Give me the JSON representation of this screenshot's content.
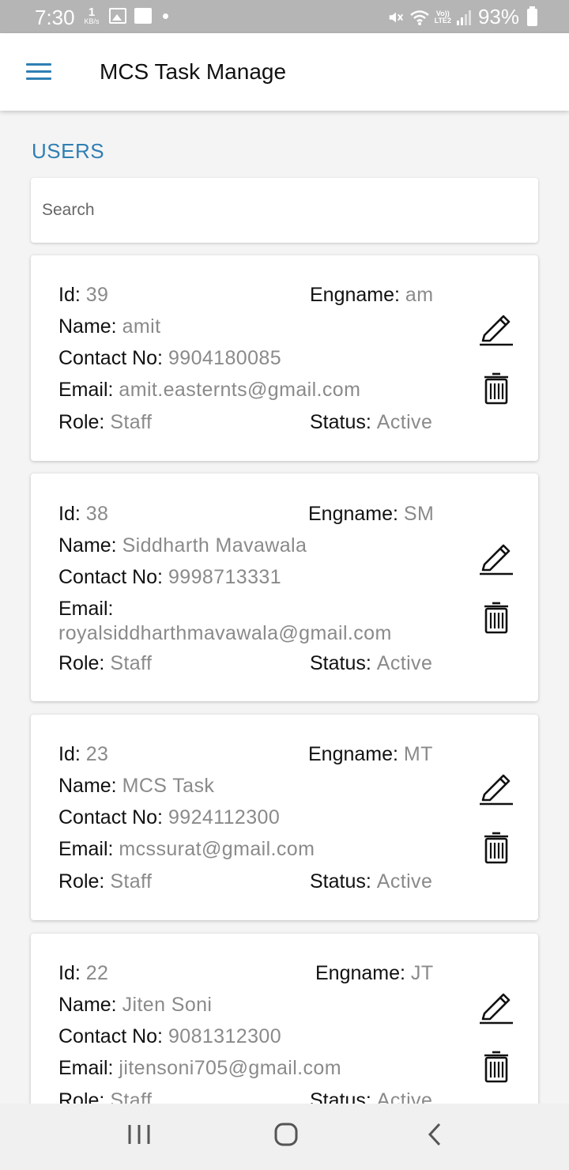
{
  "status_bar": {
    "time": "7:30",
    "net_speed": "1",
    "net_unit": "KB/s",
    "lte_top": "Vo))",
    "lte_bottom": "LTE2",
    "battery": "93%"
  },
  "app_bar": {
    "title": "MCS Task Manage"
  },
  "page": {
    "section_title": "USERS"
  },
  "search": {
    "placeholder": "Search",
    "value": ""
  },
  "labels": {
    "id": "Id:",
    "engname": "Engname:",
    "name": "Name:",
    "contact": "Contact No:",
    "email": "Email:",
    "role": "Role:",
    "status": "Status:"
  },
  "users": [
    {
      "id": "39",
      "engname": "am",
      "name": "amit",
      "contact": "9904180085",
      "email": "amit.easternts@gmail.com",
      "role": "Staff",
      "status": "Active"
    },
    {
      "id": "38",
      "engname": "SM",
      "name": "Siddharth Mavawala",
      "contact": "9998713331",
      "email": "royalsiddharthmavawala@gmail.com",
      "role": "Staff",
      "status": "Active"
    },
    {
      "id": "23",
      "engname": "MT",
      "name": "MCS Task",
      "contact": "9924112300",
      "email": "mcssurat@gmail.com",
      "role": "Staff",
      "status": "Active"
    },
    {
      "id": "22",
      "engname": "JT",
      "name": "Jiten Soni",
      "contact": "9081312300",
      "email": "jitensoni705@gmail.com",
      "role": "Staff",
      "status": "Active"
    }
  ],
  "colors": {
    "accent": "#2f7fb4",
    "status_bar": "#b5b5b5",
    "value_text": "#8a8a8a"
  }
}
